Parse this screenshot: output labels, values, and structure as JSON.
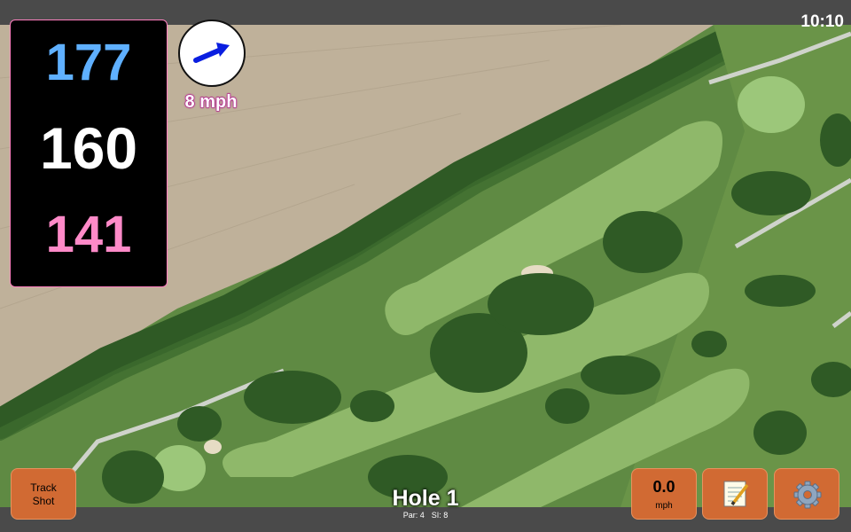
{
  "status_bar": {
    "time": "10:10"
  },
  "distances": {
    "back": "177",
    "center": "160",
    "front": "141"
  },
  "wind": {
    "label": "8 mph",
    "icon": "wind-arrow-icon",
    "direction": "east-north-east"
  },
  "hole": {
    "title": "Hole 1",
    "par_label": "Par: 4",
    "si_label": "SI: 8"
  },
  "buttons": {
    "track_shot_line1": "Track",
    "track_shot_line2": "Shot",
    "speed_value": "0.0",
    "speed_unit": "mph",
    "notes_icon": "notepad-icon",
    "settings_icon": "gear-icon"
  },
  "colors": {
    "back_distance": "#5fb0ff",
    "center_distance": "#ffffff",
    "front_distance": "#ff8ac8",
    "button_fill": "#d16a33",
    "wind_label_outline": "#b0158a"
  }
}
